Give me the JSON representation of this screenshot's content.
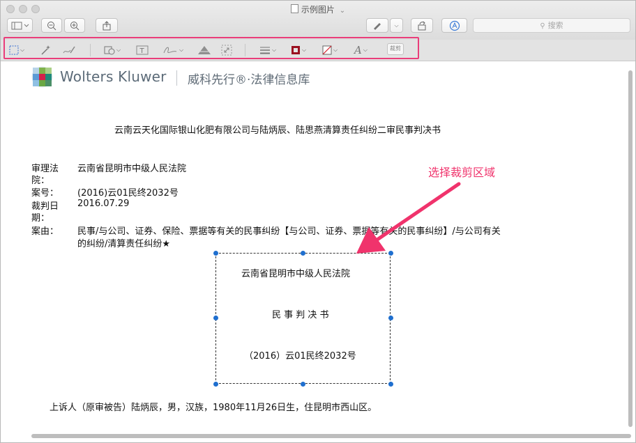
{
  "window": {
    "title": "示例图片",
    "title_caret": "⌄"
  },
  "toolbar": {
    "search_placeholder": "搜索",
    "crop_label": "裁剪"
  },
  "brand": {
    "name": "Wolters Kluwer",
    "chinese": "威科先行®·法律信息库"
  },
  "document": {
    "title": "云南云天化国际银山化肥有限公司与陆炳辰、陆思燕清算责任纠纷二审民事判决书",
    "fields": {
      "court_label_1": "审理法",
      "court_label_2": "院：",
      "court_value": "云南省昆明市中级人民法院",
      "case_no_label": "案号：",
      "case_no_value": "(2016)云01民终2032号",
      "date_label_1": "裁判日",
      "date_label_2": "期：",
      "date_value": "2016.07.29",
      "cause_label": "案由：",
      "cause_value_1": "民事/与公司、证券、保险、票据等有关的民事纠纷【与公司、证券、票据等有关的民事纠纷】/与公司有关",
      "cause_value_2": "的纠纷/清算责任纠纷★"
    },
    "crop_box": {
      "court": "云南省昆明市中级人民法院",
      "doc_type": "民 事 判 决 书",
      "case_no": "（2016）云01民终2032号"
    },
    "appellant": "上诉人（原审被告）陆炳辰，男，汉族，1980年11月26日生，住昆明市西山区。"
  },
  "annotation": {
    "text": "选择裁剪区域"
  },
  "colors": {
    "highlight": "#ea3d7a",
    "arrow": "#f0336c",
    "handle": "#1f6fcf",
    "border_tool": "#9b1020"
  }
}
